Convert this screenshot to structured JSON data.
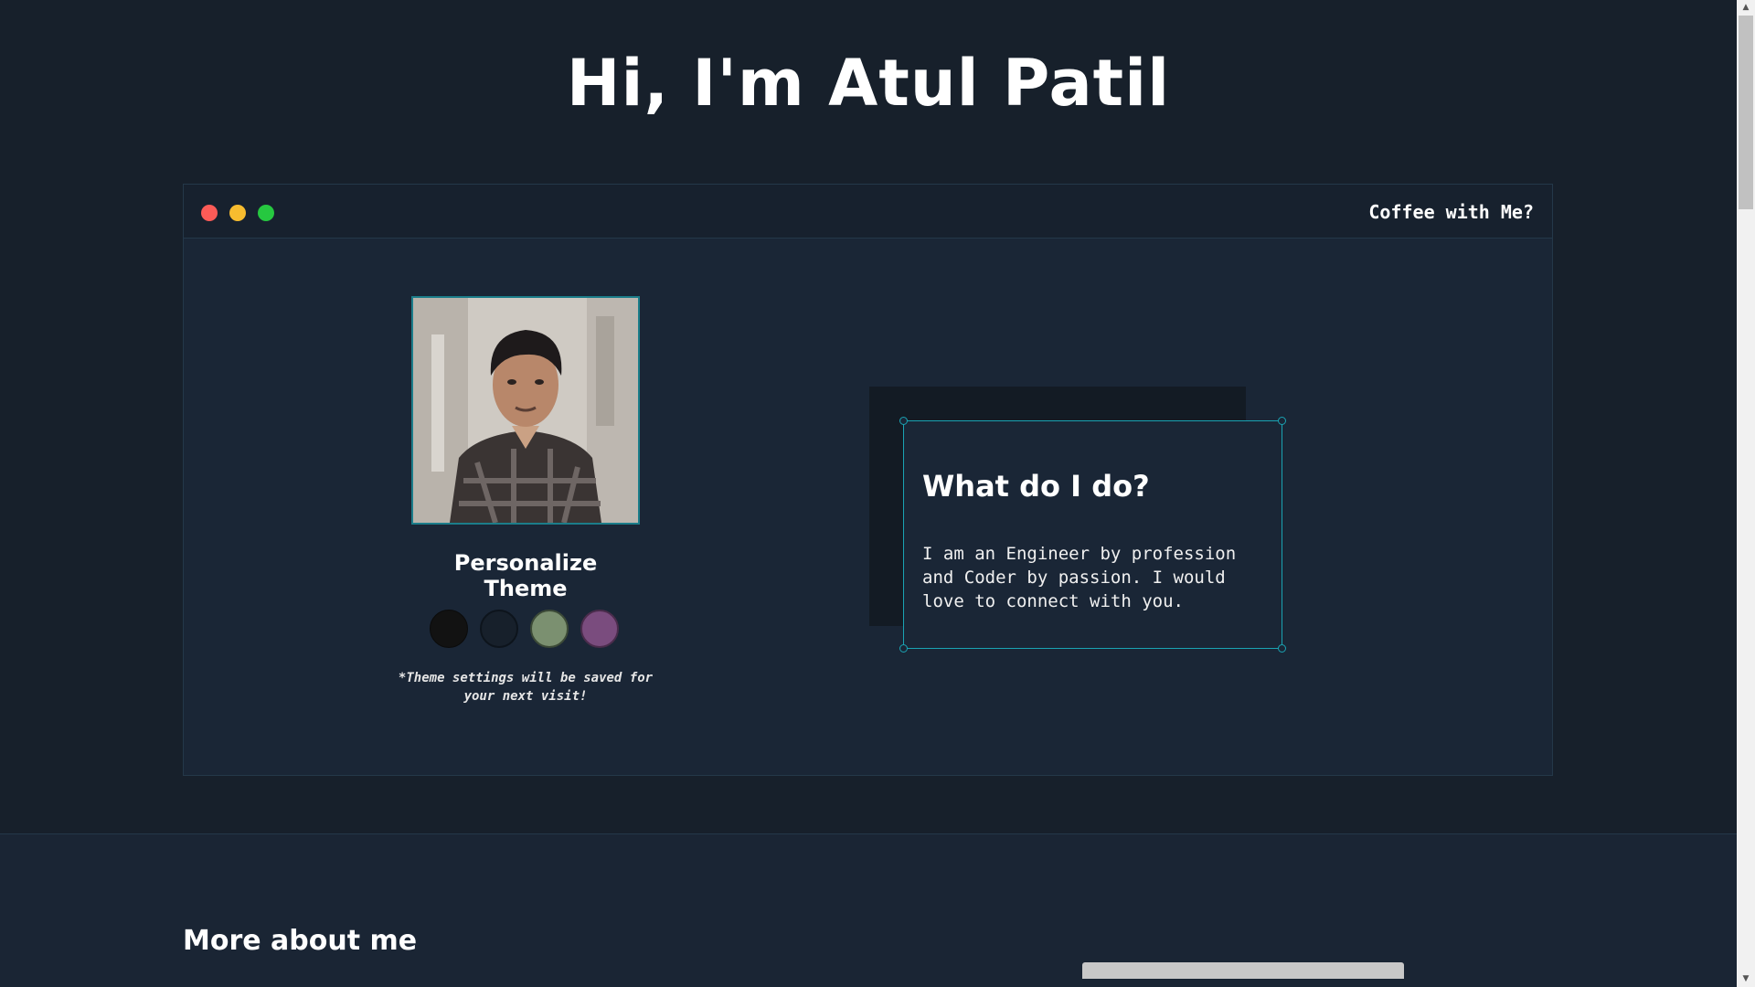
{
  "hero": {
    "title": "Hi, I'm Atul Patil"
  },
  "window": {
    "link_label": "Coffee with Me?",
    "traffic_lights": [
      "#fc5b57",
      "#f7bc2f",
      "#26c840"
    ]
  },
  "profile": {
    "personalize_title": "Personalize Theme",
    "theme_swatches": [
      {
        "name": "black",
        "color": "#121212"
      },
      {
        "name": "navy",
        "color": "#17202b"
      },
      {
        "name": "sage",
        "color": "#7b9070"
      },
      {
        "name": "plum",
        "color": "#7a4c7e"
      }
    ],
    "note": "*Theme settings will be saved for your next visit!"
  },
  "about_card": {
    "title": "What do I do?",
    "text": "I am an Engineer by profession and Coder by passion. I would love to connect with you."
  },
  "more_section": {
    "title": "More about me"
  },
  "colors": {
    "accent": "#1aa3b3",
    "background": "#17202b",
    "panel": "#1a2636"
  }
}
